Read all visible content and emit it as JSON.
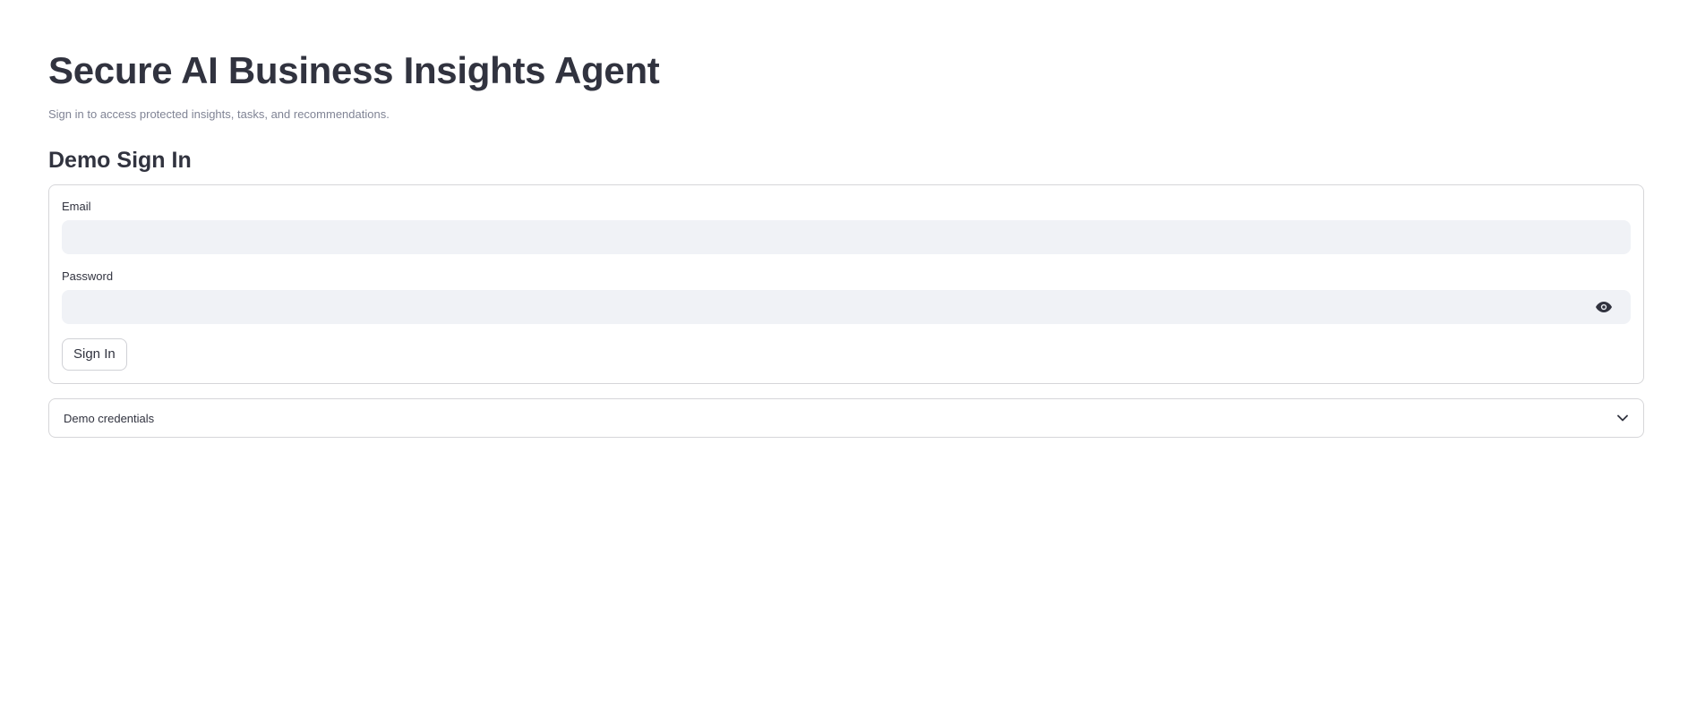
{
  "header": {
    "title": "Secure AI Business Insights Agent",
    "caption": "Sign in to access protected insights, tasks, and recommendations."
  },
  "signin": {
    "section_title": "Demo Sign In",
    "email_label": "Email",
    "email_value": "",
    "password_label": "Password",
    "password_value": "",
    "password_toggle_icon": "eye-icon",
    "submit_label": "Sign In"
  },
  "expander": {
    "label": "Demo credentials",
    "expanded": false,
    "icon": "chevron-down-icon"
  },
  "colors": {
    "text": "#31333f",
    "muted": "#808495",
    "input_bg": "#f0f2f6",
    "border": "#d6d6d9"
  }
}
